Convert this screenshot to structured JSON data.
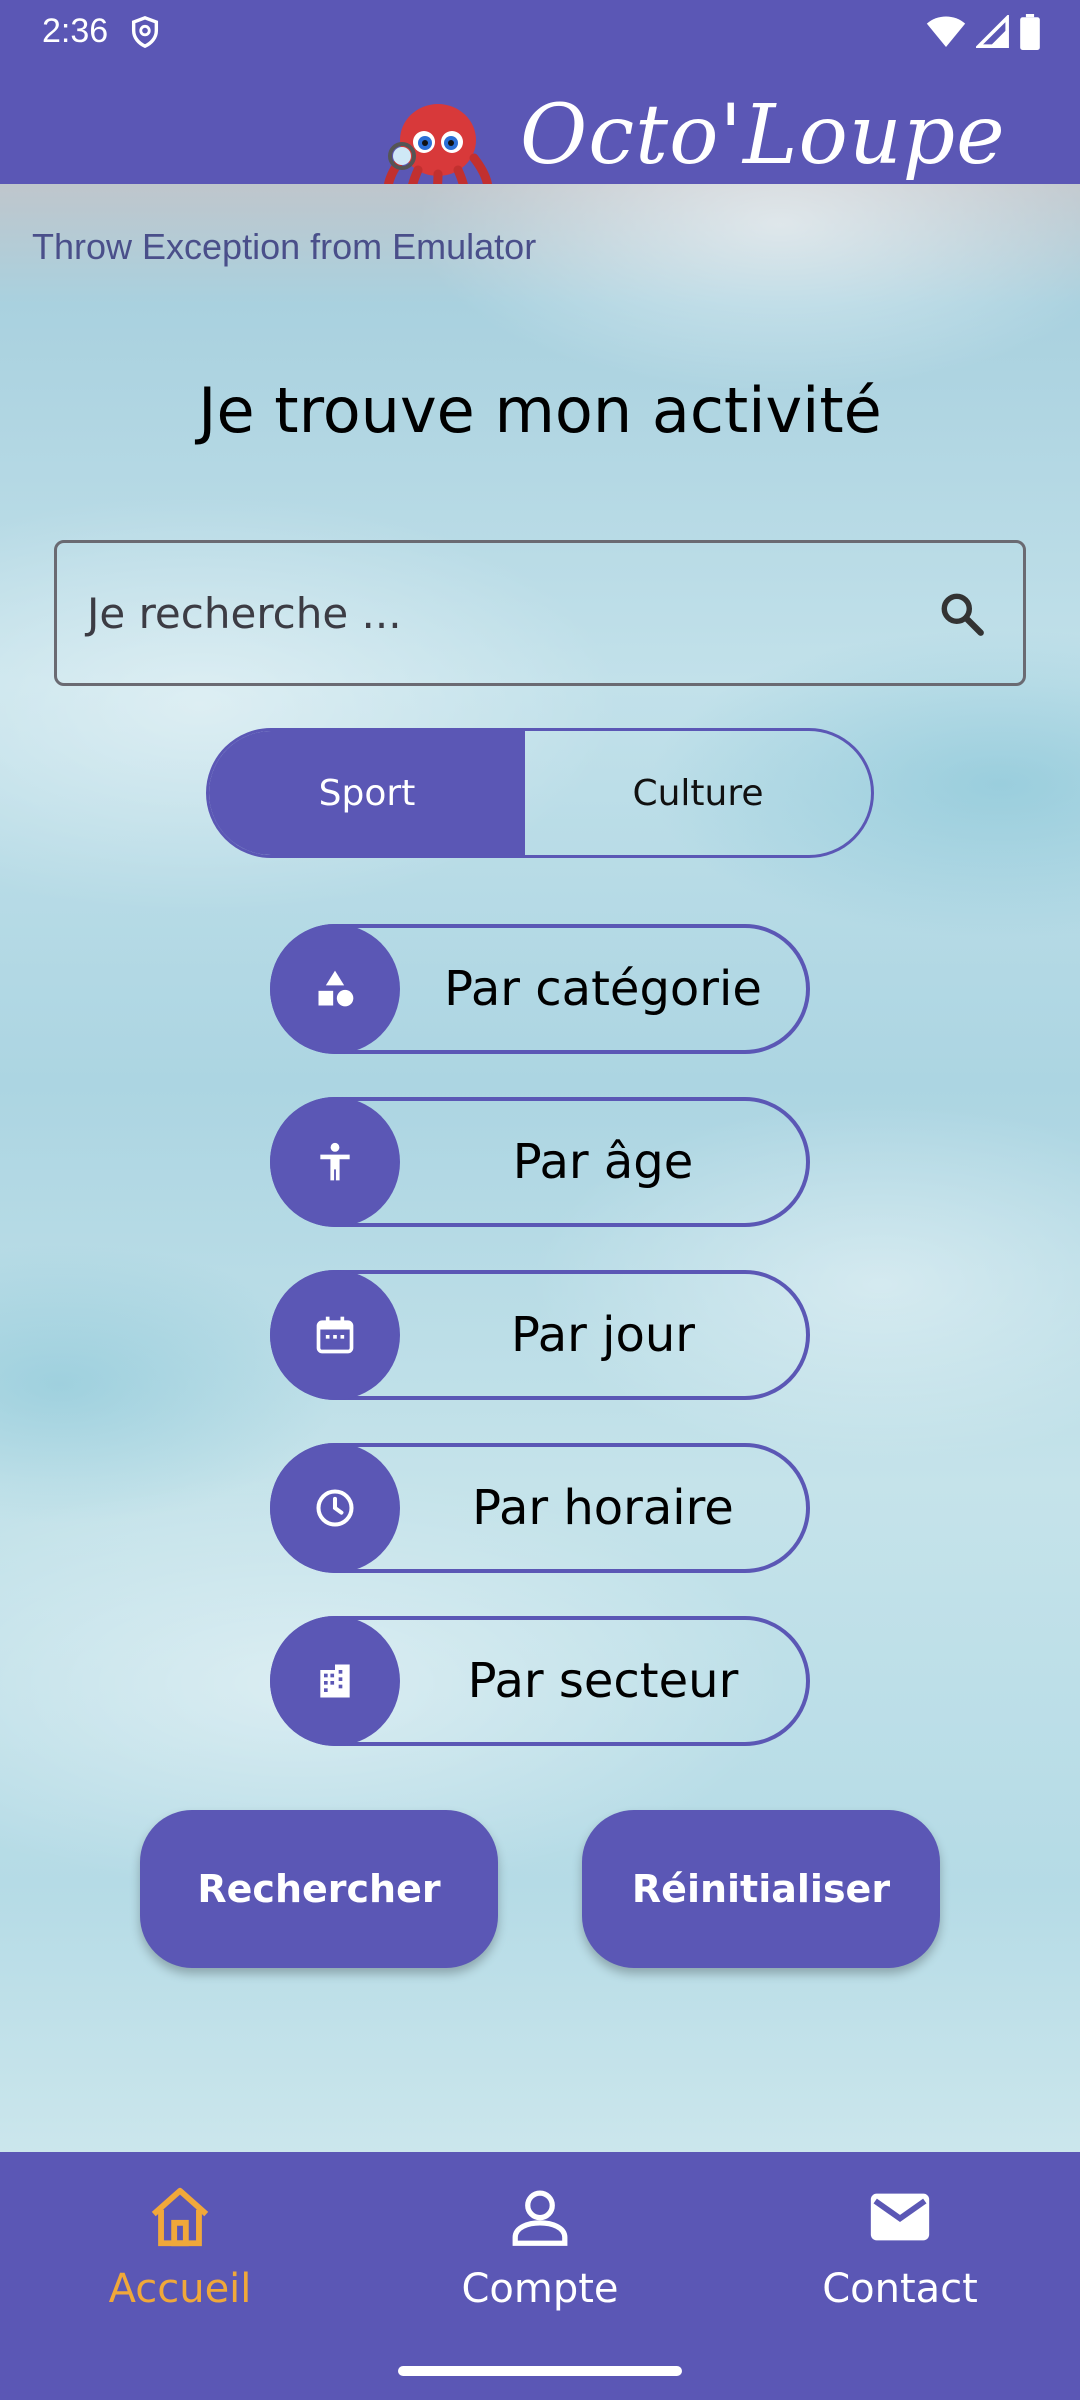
{
  "status_bar": {
    "time": "2:36"
  },
  "header": {
    "app_title": "Octo'Loupe"
  },
  "debug_banner": "Throw Exception from Emulator",
  "page_title": "Je trouve mon activité",
  "search": {
    "placeholder": "Je recherche ..."
  },
  "toggle": {
    "options": [
      "Sport",
      "Culture"
    ],
    "selected": "Sport"
  },
  "filters": [
    {
      "label": "Par catégorie",
      "icon": "category-icon"
    },
    {
      "label": "Par âge",
      "icon": "person-icon"
    },
    {
      "label": "Par jour",
      "icon": "calendar-icon"
    },
    {
      "label": "Par horaire",
      "icon": "clock-icon"
    },
    {
      "label": "Par secteur",
      "icon": "building-icon"
    }
  ],
  "actions": {
    "search_label": "Rechercher",
    "reset_label": "Réinitialiser"
  },
  "bottom_nav": {
    "items": [
      {
        "label": "Accueil",
        "icon": "home-icon",
        "active": true
      },
      {
        "label": "Compte",
        "icon": "account-icon",
        "active": false
      },
      {
        "label": "Contact",
        "icon": "mail-icon",
        "active": false
      }
    ]
  },
  "colors": {
    "primary": "#5b57b5",
    "active_nav": "#f0a83a"
  }
}
